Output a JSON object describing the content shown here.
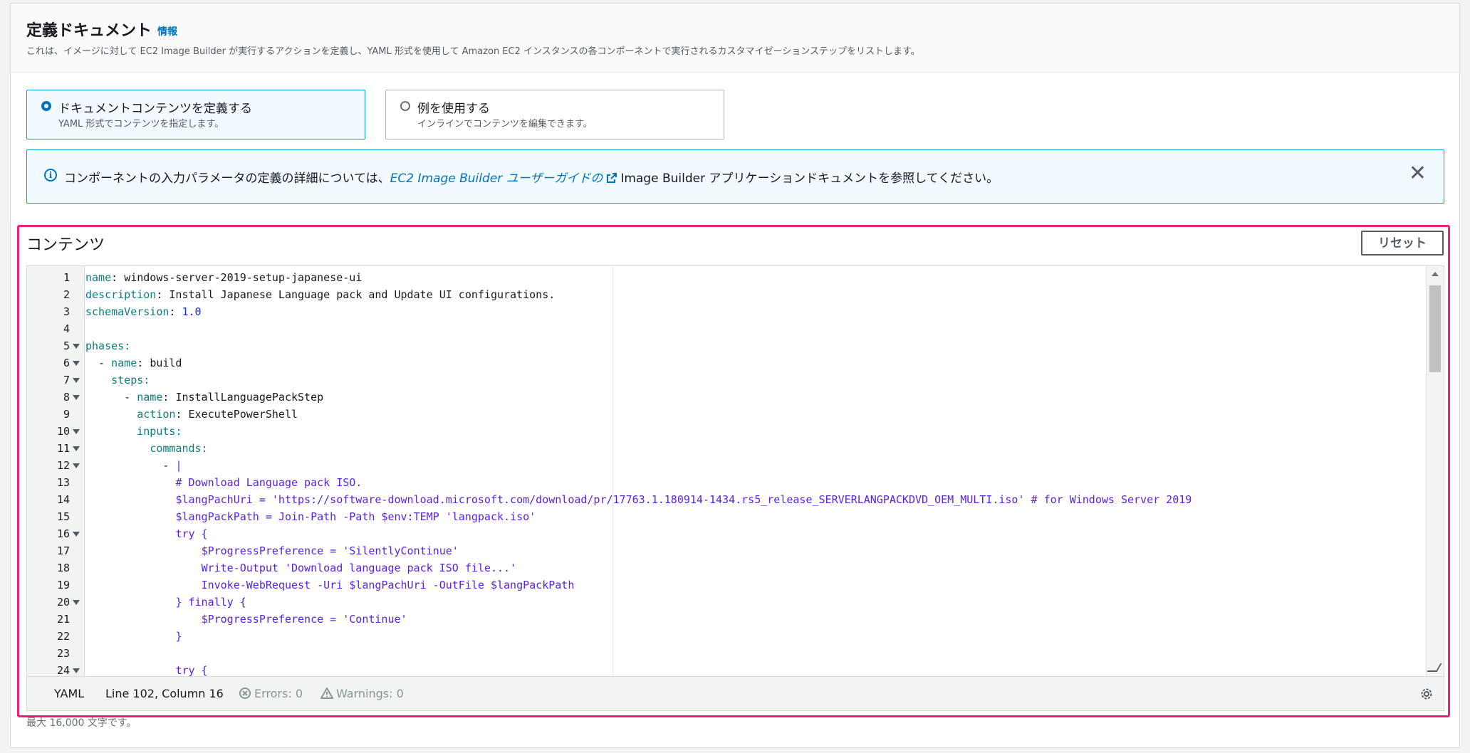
{
  "panel": {
    "title": "定義ドキュメント",
    "info_link": "情報",
    "description": "これは、イメージに対して EC2 Image Builder が実行するアクションを定義し、YAML 形式を使用して Amazon EC2 インスタンスの各コンポーネントで実行されるカスタマイゼーションステップをリストします。"
  },
  "options": [
    {
      "label": "ドキュメントコンテンツを定義する",
      "description": "YAML 形式でコンテンツを指定します。",
      "selected": true
    },
    {
      "label": "例を使用する",
      "description": "インラインでコンテンツを編集できます。",
      "selected": false
    }
  ],
  "alert": {
    "text_before": "コンポーネントの入力パラメータの定義の詳細については、",
    "link_text": "EC2 Image Builder ユーザーガイドの",
    "text_after": "Image Builder アプリケーションドキュメントを参照してください。",
    "close_icon": "close-icon",
    "info_icon": "info-icon",
    "external_icon": "external-link-icon"
  },
  "contents": {
    "label": "コンテンツ",
    "reset_label": "リセット"
  },
  "editor": {
    "lines": [
      {
        "n": "1",
        "fold": false,
        "indent": "",
        "key": "name",
        "value": "windows-server-2019-setup-japanese-ui"
      },
      {
        "n": "2",
        "fold": false,
        "indent": "",
        "key": "description",
        "value": "Install Japanese Language pack and Update UI configurations."
      },
      {
        "n": "3",
        "fold": false,
        "indent": "",
        "key": "schemaVersion",
        "value": "1.0"
      },
      {
        "n": "4",
        "fold": false,
        "indent": "",
        "key": "",
        "value": ""
      },
      {
        "n": "5",
        "fold": true,
        "indent": "",
        "key": "phases",
        "value": ""
      },
      {
        "n": "6",
        "fold": true,
        "indent": "  - ",
        "key": "name",
        "value": "build"
      },
      {
        "n": "7",
        "fold": true,
        "indent": "    ",
        "key": "steps",
        "value": ""
      },
      {
        "n": "8",
        "fold": true,
        "indent": "      - ",
        "key": "name",
        "value": "InstallLanguagePackStep"
      },
      {
        "n": "9",
        "fold": false,
        "indent": "        ",
        "key": "action",
        "value": "ExecutePowerShell"
      },
      {
        "n": "10",
        "fold": true,
        "indent": "        ",
        "key": "inputs",
        "value": ""
      },
      {
        "n": "11",
        "fold": true,
        "indent": "          ",
        "key": "commands",
        "value": ""
      },
      {
        "n": "12",
        "fold": true,
        "indent": "            - ",
        "key": "",
        "value": "|"
      },
      {
        "n": "13",
        "fold": false,
        "indent": "              ",
        "key": "",
        "value": "# Download Language pack ISO."
      },
      {
        "n": "14",
        "fold": false,
        "indent": "              ",
        "key": "",
        "value": "$langPachUri = 'https://software-download.microsoft.com/download/pr/17763.1.180914-1434.rs5_release_SERVERLANGPACKDVD_OEM_MULTI.iso' # for Windows Server 2019"
      },
      {
        "n": "15",
        "fold": false,
        "indent": "              ",
        "key": "",
        "value": "$langPackPath = Join-Path -Path $env:TEMP 'langpack.iso'"
      },
      {
        "n": "16",
        "fold": true,
        "indent": "              ",
        "key": "",
        "value": "try {"
      },
      {
        "n": "17",
        "fold": false,
        "indent": "                  ",
        "key": "",
        "value": "$ProgressPreference = 'SilentlyContinue'"
      },
      {
        "n": "18",
        "fold": false,
        "indent": "                  ",
        "key": "",
        "value": "Write-Output 'Download language pack ISO file...'"
      },
      {
        "n": "19",
        "fold": false,
        "indent": "                  ",
        "key": "",
        "value": "Invoke-WebRequest -Uri $langPachUri -OutFile $langPackPath"
      },
      {
        "n": "20",
        "fold": true,
        "indent": "              ",
        "key": "",
        "value": "} finally {"
      },
      {
        "n": "21",
        "fold": false,
        "indent": "                  ",
        "key": "",
        "value": "$ProgressPreference = 'Continue'"
      },
      {
        "n": "22",
        "fold": false,
        "indent": "              ",
        "key": "",
        "value": "}"
      },
      {
        "n": "23",
        "fold": false,
        "indent": "",
        "key": "",
        "value": ""
      },
      {
        "n": "24",
        "fold": true,
        "indent": "              ",
        "key": "",
        "value": "try {"
      }
    ],
    "colors": {
      "key": "#0e7c7b",
      "string": "#5a21e6",
      "plain": "#16191f",
      "number": "#1f2fd6"
    }
  },
  "statusbar": {
    "language": "YAML",
    "position": "Line 102, Column 16",
    "errors": "Errors: 0",
    "warnings": "Warnings: 0",
    "errors_icon": "error-circle-icon",
    "warnings_icon": "warning-triangle-icon",
    "settings_icon": "gear-icon"
  },
  "char_limit": "最大 16,000 文字です。"
}
